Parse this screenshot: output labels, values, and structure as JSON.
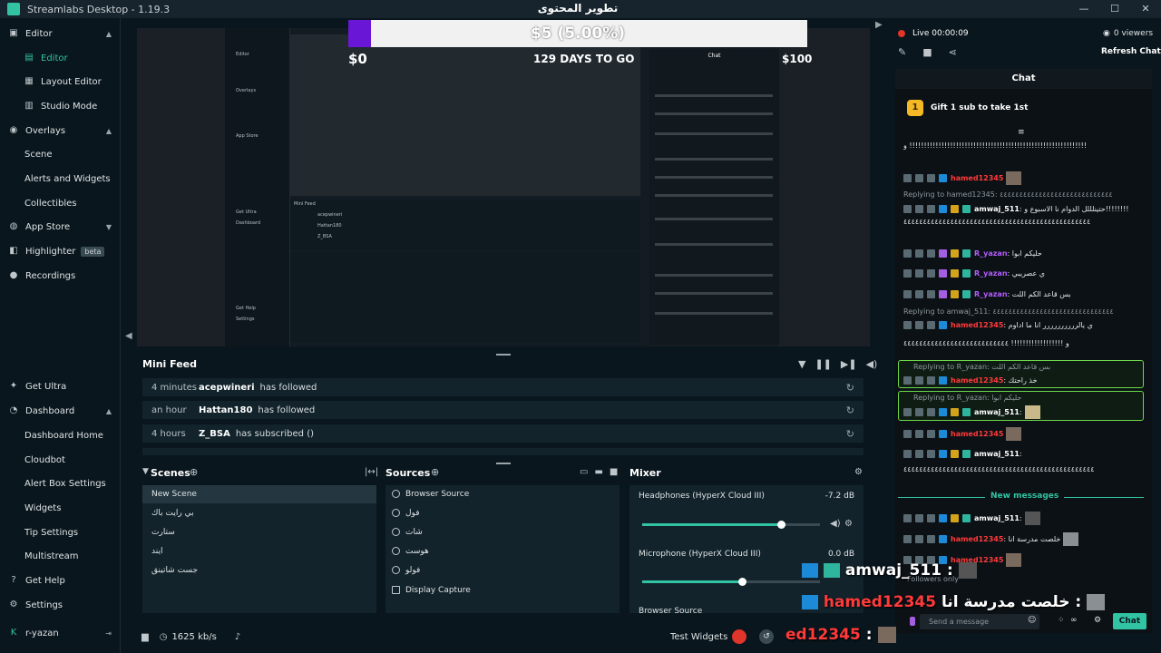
{
  "window": {
    "title": "Streamlabs Desktop - 1.19.3",
    "controls": [
      "—",
      "☐",
      "✕"
    ]
  },
  "sidebar": {
    "sections": [
      {
        "label": "Editor",
        "icon": "editor-icon"
      },
      {
        "label": "Overlays",
        "icon": "overlays-icon"
      },
      {
        "label": "App Store",
        "icon": "app-store-icon"
      },
      {
        "label": "Highlighter",
        "icon": "highlighter-icon",
        "badge": "beta"
      },
      {
        "label": "Recordings",
        "icon": "recordings-icon"
      }
    ],
    "editor_items": [
      "Editor",
      "Layout Editor",
      "Studio Mode"
    ],
    "overlay_items": [
      "Scene",
      "Alerts and Widgets",
      "Collectibles"
    ],
    "bottom": {
      "get_ultra": "Get Ultra",
      "dashboard": "Dashboard",
      "dashboard_items": [
        "Dashboard Home",
        "Cloudbot",
        "Alert Box Settings",
        "Widgets",
        "Tip Settings",
        "Multistream"
      ],
      "get_help": "Get Help",
      "settings": "Settings",
      "user": "r-yazan"
    }
  },
  "preview": {
    "goal_title": "تطوير المحتوى",
    "goal_text": "$5 (5.00%)",
    "goal_progress": 0.05,
    "goal_min": "$0",
    "goal_days": "129 DAYS TO GO",
    "goal_max": "$100"
  },
  "mini_feed": {
    "title": "Mini Feed",
    "rows": [
      {
        "time": "4 minutes",
        "name": "acepwineri",
        "action": "has followed"
      },
      {
        "time": "an hour",
        "name": "Hattan180",
        "action": "has followed"
      },
      {
        "time": "4 hours",
        "name": "Z_BSA",
        "action": "has subscribed ()"
      }
    ]
  },
  "scenes": {
    "title": "Scenes",
    "items": [
      "New Scene",
      "بي رايت باك",
      "ستارت",
      "ايند",
      "جست شاتينق"
    ]
  },
  "sources": {
    "title": "Sources",
    "items": [
      "Browser Source",
      "فول",
      "شات",
      "هوست",
      "فولو",
      "Display Capture"
    ]
  },
  "mixer": {
    "title": "Mixer",
    "channels": [
      {
        "name": "Headphones (HyperX Cloud III)",
        "db": "-7.2 dB",
        "level": 0.78
      },
      {
        "name": "Microphone (HyperX Cloud III)",
        "db": "0.0 dB",
        "level": 0.56
      },
      {
        "name": "Browser Source",
        "db": ""
      }
    ]
  },
  "statusbar": {
    "bitrate": "1625 kb/s",
    "test_widgets": "Test Widgets"
  },
  "live": {
    "status": "Live 00:00:09",
    "viewers": "0 viewers",
    "refresh": "Refresh Chat"
  },
  "chat": {
    "title": "Chat",
    "gift": "Gift 1 sub to take 1st",
    "lines": [
      {
        "user": "",
        "text": "و !!!!!!!!!!!!!!!!!!!!!!!!!!!!!!!!!!!!!!!!!!!!!!!!!!!!!!!!!!!!!"
      },
      {
        "user": "hamed12345",
        "text": ""
      },
      {
        "reply": "Replying to hamed12345: ٤٤٤٤٤٤٤٤٤٤٤٤٤٤٤٤٤٤٤٤٤٤٤٤٤٤٤٤٤"
      },
      {
        "user": "amwaj_511",
        "text": "حتينلللل الدوام نا الاسبوع و!!!!!!!!"
      },
      {
        "user": "",
        "text": "٤٤٤٤٤٤٤٤٤٤٤٤٤٤٤٤٤٤٤٤٤٤٤٤٤٤٤٤٤٤٤٤٤٤٤٤٤٤٤٤٤٤٤٤٤٤٤٤"
      },
      {
        "user": "R_yazan",
        "text": "حليكم ابوا"
      },
      {
        "user": "R_yazan",
        "text": "ي عصريبي"
      },
      {
        "user": "R_yazan",
        "text": "بس قاعد الكم اللت"
      },
      {
        "reply": "Replying to amwaj_511: ٤٤٤٤٤٤٤٤٤٤٤٤٤٤٤٤٤٤٤٤٤٤٤٤٤٤٤٤٤٤٤"
      },
      {
        "user": "hamed12345",
        "text": "ي يالرررررررررر انا ما اداوم"
      },
      {
        "user": "",
        "text": "و !!!!!!!!!!!!!!!!!! ٤٤٤٤٤٤٤٤٤٤٤٤٤٤٤٤٤٤٤٤٤٤٤٤٤٤٤"
      },
      {
        "reply": "Replying to R_yazan: بس قاعد الكم اللت"
      },
      {
        "user": "hamed12345",
        "text": "خذ راحتك"
      },
      {
        "reply": "Replying to R_yazan: حليكم ابوا"
      },
      {
        "user": "amwaj_511",
        "text": ""
      },
      {
        "user": "hamed12345",
        "text": ""
      },
      {
        "user": "amwaj_511",
        "text": ""
      },
      {
        "user": "",
        "text": "٤٤٤٤٤٤٤٤٤٤٤٤٤٤٤٤٤٤٤٤٤٤٤٤٤٤٤٤٤٤٤٤٤٤٤٤٤٤٤٤٤٤٤٤٤٤٤٤٤"
      },
      {
        "new": "New messages"
      },
      {
        "user": "amwaj_511",
        "text": ""
      },
      {
        "user": "hamed12345",
        "text": "خلصت مدرسة انا"
      },
      {
        "user": "hamed12345",
        "text": ""
      }
    ],
    "followers_only": "Followers only",
    "send_placeholder": "Send a message",
    "chat_button": "Chat"
  },
  "overlay_chat": [
    {
      "user": "amwaj_511",
      "text": ":"
    },
    {
      "user": "hamed12345",
      "text": "خلصت مدرسة انا :"
    },
    {
      "user": "ed12345",
      "text": ":"
    }
  ],
  "colors": {
    "accent": "#31c3a2",
    "goal_fill": "#6a16d6",
    "live": "#e0352a",
    "highlight": "#6cd94a"
  }
}
